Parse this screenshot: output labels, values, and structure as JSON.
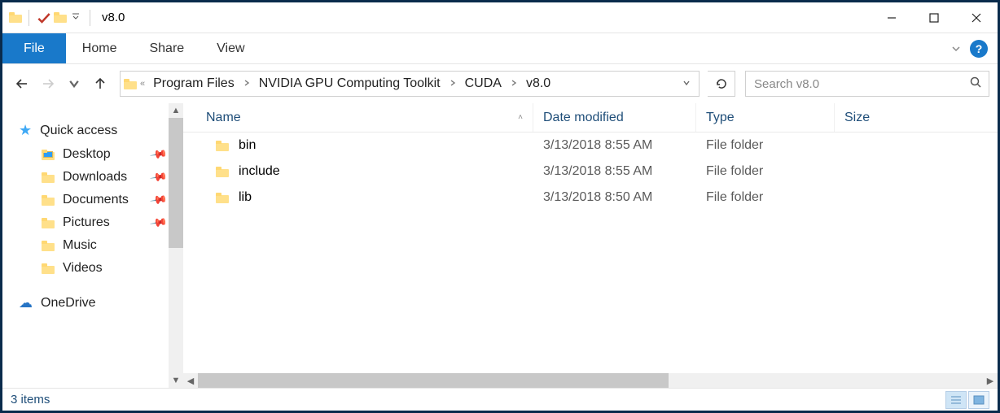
{
  "title": "v8.0",
  "ribbon": {
    "file": "File",
    "home": "Home",
    "share": "Share",
    "view": "View"
  },
  "breadcrumbs": [
    "Program Files",
    "NVIDIA GPU Computing Toolkit",
    "CUDA",
    "v8.0"
  ],
  "search_placeholder": "Search v8.0",
  "sidebar": {
    "quick_access": "Quick access",
    "desktop": "Desktop",
    "downloads": "Downloads",
    "documents": "Documents",
    "pictures": "Pictures",
    "music": "Music",
    "videos": "Videos",
    "onedrive": "OneDrive"
  },
  "columns": {
    "name": "Name",
    "date": "Date modified",
    "type": "Type",
    "size": "Size"
  },
  "files": [
    {
      "name": "bin",
      "date": "3/13/2018 8:55 AM",
      "type": "File folder",
      "size": ""
    },
    {
      "name": "include",
      "date": "3/13/2018 8:55 AM",
      "type": "File folder",
      "size": ""
    },
    {
      "name": "lib",
      "date": "3/13/2018 8:50 AM",
      "type": "File folder",
      "size": ""
    }
  ],
  "status": "3 items"
}
